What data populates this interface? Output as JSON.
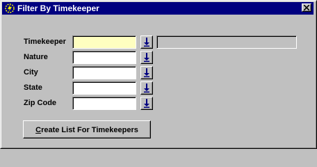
{
  "window": {
    "title": "Filter By Timekeeper",
    "title_icon": "lightning-gear-icon",
    "close_icon": "close-icon",
    "titlebar_color": "#000080",
    "background_color": "#c0c0c0"
  },
  "fields": [
    {
      "label": "Timekeeper",
      "value": "",
      "active": true,
      "active_color": "#ffffc0"
    },
    {
      "label": "Nature",
      "value": ""
    },
    {
      "label": "City",
      "value": ""
    },
    {
      "label": "State",
      "value": ""
    },
    {
      "label": "Zip Code",
      "value": ""
    }
  ],
  "lov_icon": "down-arrow-icon",
  "lov_icon_color": "#000080",
  "timekeeper_description": "",
  "action_button": {
    "mnemonic": "C",
    "rest": "reate List For Timekeepers"
  }
}
